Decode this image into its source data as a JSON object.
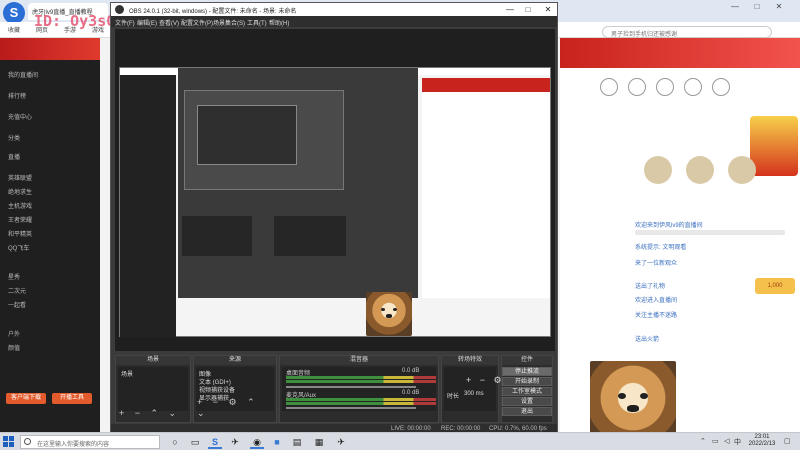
{
  "browser": {
    "tab_title": "虎牙|lv9直播_直播教程",
    "bookmarks": [
      "收藏",
      "网页",
      "手游",
      "游戏"
    ],
    "search_placeholder": "男子捡到手机归还被感谢",
    "watermark": "ID: Oy3s0Z 昵称: 伊风lv9",
    "side_items": [
      "我的直播间",
      "排行榜",
      "充值中心",
      "分类",
      "直播",
      "英雄联盟",
      "绝地求生",
      "主机游戏",
      "王者荣耀",
      "和平精英",
      "QQ飞车",
      "星秀",
      "二次元",
      "一起看",
      "户外",
      "颜值"
    ],
    "side_buttons": [
      "客户端下载",
      "开播工具"
    ],
    "chat_texts": [
      "欢迎来到伊风lv9的直播间",
      "系统提示: 文明观看",
      "来了一位新观众",
      "送出了礼物",
      "欢迎进入直播间",
      "关注主播不迷路",
      "送出火箭",
      "主播好厉害"
    ],
    "gift_label": "1,000",
    "colors": {
      "brand": "#c8231c",
      "accent": "#f5c14c",
      "link": "#3a6fc0"
    }
  },
  "obs": {
    "title": "OBS 24.0.1 (32-bit, windows) - 配置文件: 未命名 - 场景: 未命名",
    "menu": [
      "文件(F)",
      "编辑(E)",
      "查看(V)",
      "配置文件(P)",
      "场景集合(S)",
      "工具(T)",
      "帮助(H)"
    ],
    "docks": {
      "scenes": {
        "title": "场景",
        "items": [
          "场景"
        ]
      },
      "sources": {
        "title": "来源",
        "items": [
          "图像",
          "文本 (GDI+)",
          "视频捕获设备",
          "显示器捕获"
        ]
      },
      "mixer": {
        "title": "混音器",
        "channels": [
          {
            "name": "麦克风/Aux",
            "db": "0.0 dB"
          },
          {
            "name": "桌面音频",
            "db": "0.0 dB"
          }
        ]
      },
      "transitions": {
        "title": "转场特效",
        "duration_label": "时长",
        "duration_value": "300 ms"
      },
      "controls": {
        "title": "控件",
        "buttons": [
          "停止推流",
          "开始录制",
          "工作室模式",
          "设置",
          "退出"
        ]
      }
    },
    "status": {
      "live": "LIVE: 00:00:00",
      "rec": "REC: 00:00:00",
      "cpu": "CPU: 0.7%, 60.00 fps"
    }
  },
  "taskbar": {
    "search_placeholder": "在这里输入你要搜索的内容",
    "time": "23:01",
    "date": "2022/2/13",
    "apps": [
      "task-view",
      "browser",
      "game",
      "obs",
      "file-explorer",
      "store",
      "edge",
      "music"
    ]
  }
}
